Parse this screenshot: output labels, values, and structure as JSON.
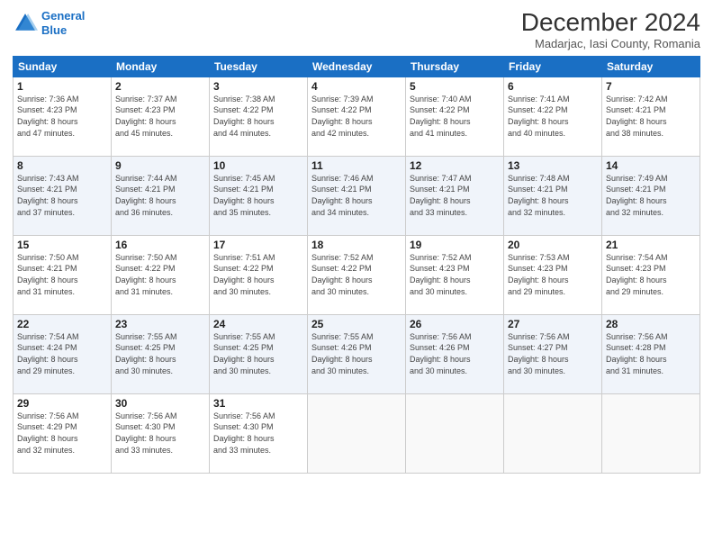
{
  "logo": {
    "line1": "General",
    "line2": "Blue"
  },
  "title": "December 2024",
  "subtitle": "Madarjac, Iasi County, Romania",
  "days_header": [
    "Sunday",
    "Monday",
    "Tuesday",
    "Wednesday",
    "Thursday",
    "Friday",
    "Saturday"
  ],
  "weeks": [
    [
      {
        "day": "1",
        "info": "Sunrise: 7:36 AM\nSunset: 4:23 PM\nDaylight: 8 hours\nand 47 minutes."
      },
      {
        "day": "2",
        "info": "Sunrise: 7:37 AM\nSunset: 4:23 PM\nDaylight: 8 hours\nand 45 minutes."
      },
      {
        "day": "3",
        "info": "Sunrise: 7:38 AM\nSunset: 4:22 PM\nDaylight: 8 hours\nand 44 minutes."
      },
      {
        "day": "4",
        "info": "Sunrise: 7:39 AM\nSunset: 4:22 PM\nDaylight: 8 hours\nand 42 minutes."
      },
      {
        "day": "5",
        "info": "Sunrise: 7:40 AM\nSunset: 4:22 PM\nDaylight: 8 hours\nand 41 minutes."
      },
      {
        "day": "6",
        "info": "Sunrise: 7:41 AM\nSunset: 4:22 PM\nDaylight: 8 hours\nand 40 minutes."
      },
      {
        "day": "7",
        "info": "Sunrise: 7:42 AM\nSunset: 4:21 PM\nDaylight: 8 hours\nand 38 minutes."
      }
    ],
    [
      {
        "day": "8",
        "info": "Sunrise: 7:43 AM\nSunset: 4:21 PM\nDaylight: 8 hours\nand 37 minutes."
      },
      {
        "day": "9",
        "info": "Sunrise: 7:44 AM\nSunset: 4:21 PM\nDaylight: 8 hours\nand 36 minutes."
      },
      {
        "day": "10",
        "info": "Sunrise: 7:45 AM\nSunset: 4:21 PM\nDaylight: 8 hours\nand 35 minutes."
      },
      {
        "day": "11",
        "info": "Sunrise: 7:46 AM\nSunset: 4:21 PM\nDaylight: 8 hours\nand 34 minutes."
      },
      {
        "day": "12",
        "info": "Sunrise: 7:47 AM\nSunset: 4:21 PM\nDaylight: 8 hours\nand 33 minutes."
      },
      {
        "day": "13",
        "info": "Sunrise: 7:48 AM\nSunset: 4:21 PM\nDaylight: 8 hours\nand 32 minutes."
      },
      {
        "day": "14",
        "info": "Sunrise: 7:49 AM\nSunset: 4:21 PM\nDaylight: 8 hours\nand 32 minutes."
      }
    ],
    [
      {
        "day": "15",
        "info": "Sunrise: 7:50 AM\nSunset: 4:21 PM\nDaylight: 8 hours\nand 31 minutes."
      },
      {
        "day": "16",
        "info": "Sunrise: 7:50 AM\nSunset: 4:22 PM\nDaylight: 8 hours\nand 31 minutes."
      },
      {
        "day": "17",
        "info": "Sunrise: 7:51 AM\nSunset: 4:22 PM\nDaylight: 8 hours\nand 30 minutes."
      },
      {
        "day": "18",
        "info": "Sunrise: 7:52 AM\nSunset: 4:22 PM\nDaylight: 8 hours\nand 30 minutes."
      },
      {
        "day": "19",
        "info": "Sunrise: 7:52 AM\nSunset: 4:23 PM\nDaylight: 8 hours\nand 30 minutes."
      },
      {
        "day": "20",
        "info": "Sunrise: 7:53 AM\nSunset: 4:23 PM\nDaylight: 8 hours\nand 29 minutes."
      },
      {
        "day": "21",
        "info": "Sunrise: 7:54 AM\nSunset: 4:23 PM\nDaylight: 8 hours\nand 29 minutes."
      }
    ],
    [
      {
        "day": "22",
        "info": "Sunrise: 7:54 AM\nSunset: 4:24 PM\nDaylight: 8 hours\nand 29 minutes."
      },
      {
        "day": "23",
        "info": "Sunrise: 7:55 AM\nSunset: 4:25 PM\nDaylight: 8 hours\nand 30 minutes."
      },
      {
        "day": "24",
        "info": "Sunrise: 7:55 AM\nSunset: 4:25 PM\nDaylight: 8 hours\nand 30 minutes."
      },
      {
        "day": "25",
        "info": "Sunrise: 7:55 AM\nSunset: 4:26 PM\nDaylight: 8 hours\nand 30 minutes."
      },
      {
        "day": "26",
        "info": "Sunrise: 7:56 AM\nSunset: 4:26 PM\nDaylight: 8 hours\nand 30 minutes."
      },
      {
        "day": "27",
        "info": "Sunrise: 7:56 AM\nSunset: 4:27 PM\nDaylight: 8 hours\nand 30 minutes."
      },
      {
        "day": "28",
        "info": "Sunrise: 7:56 AM\nSunset: 4:28 PM\nDaylight: 8 hours\nand 31 minutes."
      }
    ],
    [
      {
        "day": "29",
        "info": "Sunrise: 7:56 AM\nSunset: 4:29 PM\nDaylight: 8 hours\nand 32 minutes."
      },
      {
        "day": "30",
        "info": "Sunrise: 7:56 AM\nSunset: 4:30 PM\nDaylight: 8 hours\nand 33 minutes."
      },
      {
        "day": "31",
        "info": "Sunrise: 7:56 AM\nSunset: 4:30 PM\nDaylight: 8 hours\nand 33 minutes."
      },
      {
        "day": "",
        "info": ""
      },
      {
        "day": "",
        "info": ""
      },
      {
        "day": "",
        "info": ""
      },
      {
        "day": "",
        "info": ""
      }
    ]
  ]
}
